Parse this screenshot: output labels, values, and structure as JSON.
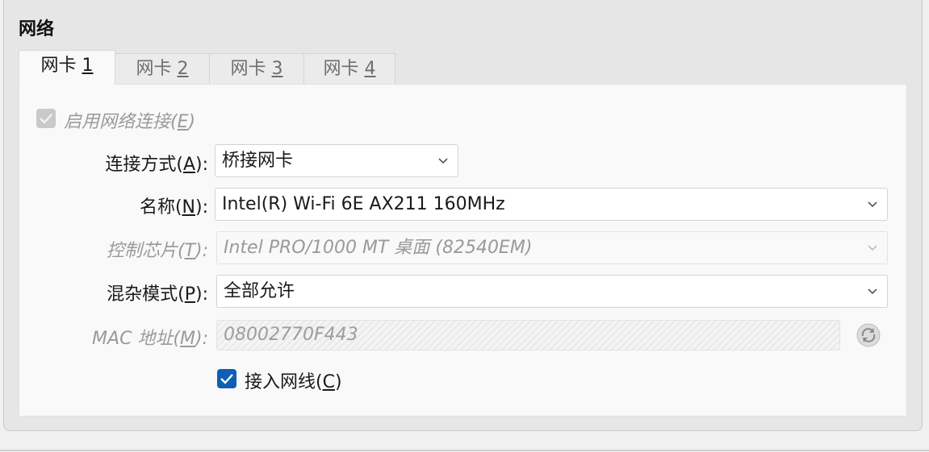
{
  "section": {
    "title": "网络"
  },
  "tabs": [
    {
      "prefix": "网卡 ",
      "num": "1",
      "active": true
    },
    {
      "prefix": "网卡 ",
      "num": "2",
      "active": false
    },
    {
      "prefix": "网卡 ",
      "num": "3",
      "active": false
    },
    {
      "prefix": "网卡 ",
      "num": "4",
      "active": false
    }
  ],
  "enable": {
    "pre": "启用网络连接(",
    "key": "E",
    "post": ")",
    "checked": true,
    "disabled": true
  },
  "attach": {
    "pre": "连接方式(",
    "key": "A",
    "post": "):",
    "value": "桥接网卡"
  },
  "name": {
    "pre": "名称(",
    "key": "N",
    "post": "):",
    "value": "Intel(R) Wi-Fi 6E AX211 160MHz"
  },
  "adapter": {
    "pre": "控制芯片(",
    "key": "T",
    "post": "):",
    "value": "Intel PRO/1000 MT 桌面 (82540EM)"
  },
  "promisc": {
    "pre": "混杂模式(",
    "key": "P",
    "post": "):",
    "value": "全部允许"
  },
  "mac": {
    "pre": "MAC 地址(",
    "key": "M",
    "post": "):",
    "value": "08002770F443"
  },
  "cable": {
    "pre": "接入网线(",
    "key": "C",
    "post": ")",
    "checked": true
  },
  "icons": {
    "chevron": "chevron-down-icon",
    "refresh": "refresh-mac-icon",
    "check": "checkmark-icon"
  },
  "colors": {
    "accent": "#0f5fb5",
    "disabled_text": "#9a9a9a"
  }
}
